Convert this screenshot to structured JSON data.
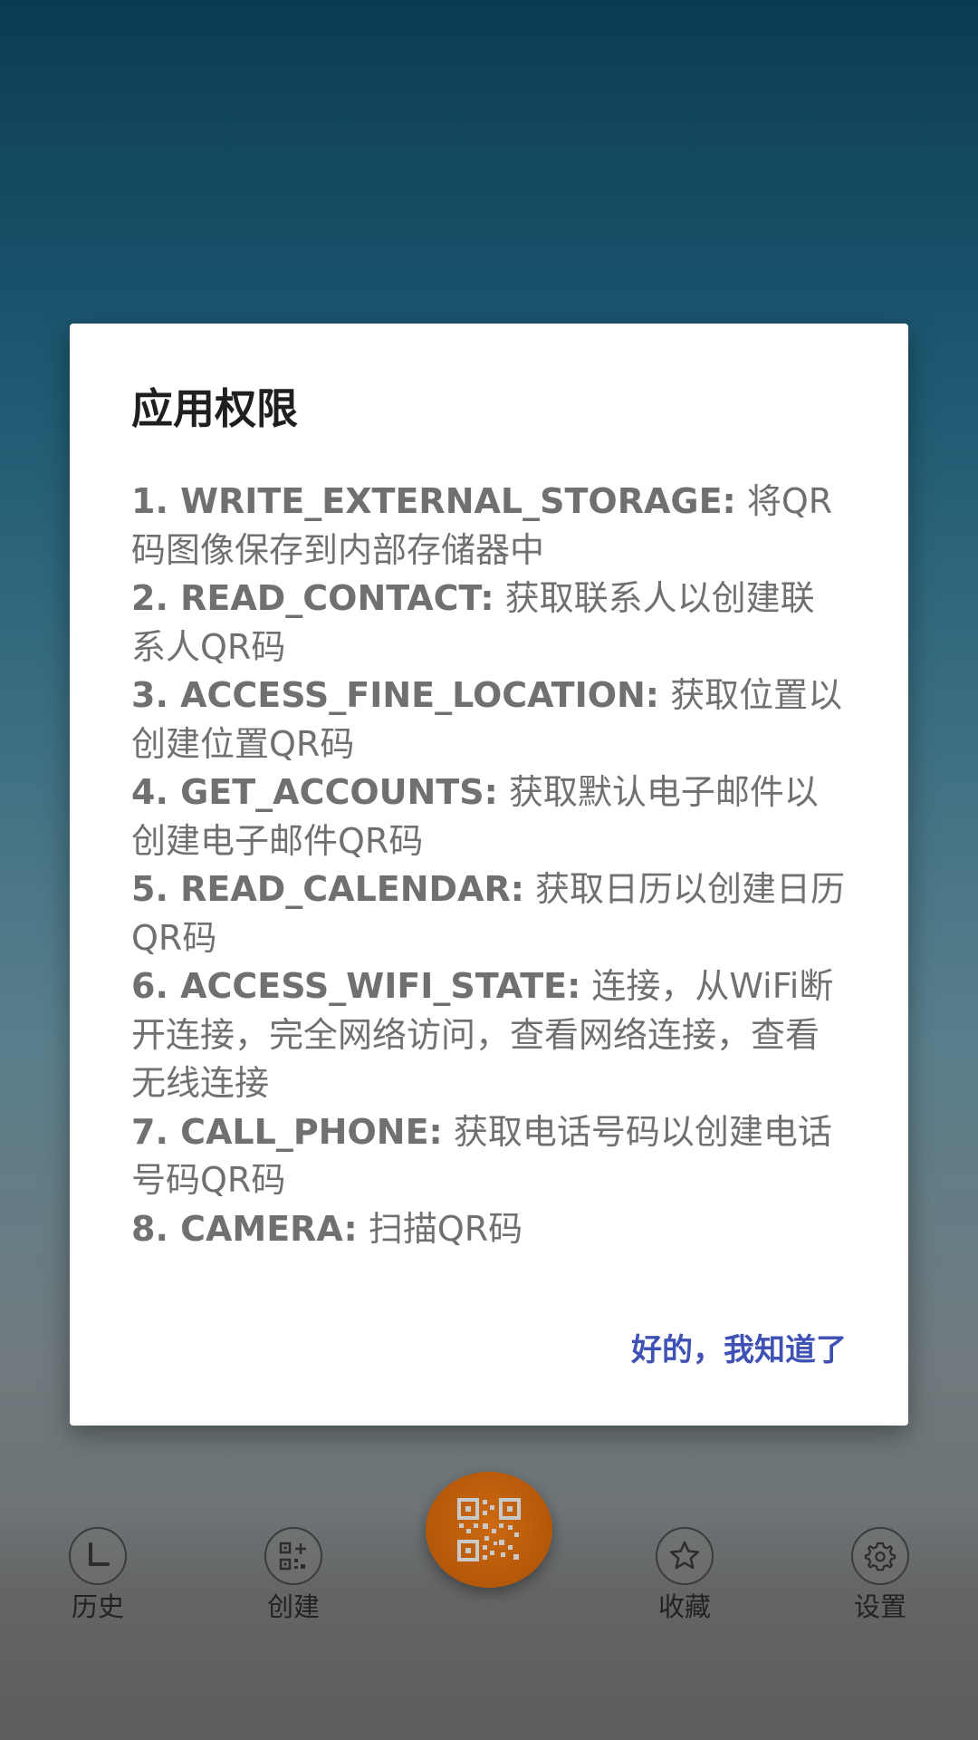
{
  "dialog": {
    "title": "应用权限",
    "permissions": [
      {
        "key": "1. WRITE_EXTERNAL_STORAGE:",
        "desc": " 将QR码图像保存到内部存储器中"
      },
      {
        "key": "2. READ_CONTACT:",
        "desc": " 获取联系人以创建联系人QR码"
      },
      {
        "key": "3. ACCESS_FINE_LOCATION:",
        "desc": " 获取位置以创建位置QR码"
      },
      {
        "key": "4. GET_ACCOUNTS:",
        "desc": " 获取默认电子邮件以创建电子邮件QR码"
      },
      {
        "key": "5. READ_CALENDAR:",
        "desc": " 获取日历以创建日历QR码"
      },
      {
        "key": "6. ACCESS_WIFI_STATE:",
        "desc": " 连接，从WiFi断开连接，完全网络访问，查看网络连接，查看无线连接"
      },
      {
        "key": "7. CALL_PHONE:",
        "desc": " 获取电话号码以创建电话号码QR码"
      },
      {
        "key": "8. CAMERA:",
        "desc": " 扫描QR码"
      }
    ],
    "ok_label": "好的，我知道了"
  },
  "bottom_nav": {
    "items": [
      {
        "label": "历史",
        "icon": "clock-icon"
      },
      {
        "label": "创建",
        "icon": "qr-create-icon"
      },
      {
        "label": "收藏",
        "icon": "star-icon"
      },
      {
        "label": "设置",
        "icon": "gear-icon"
      }
    ],
    "fab_icon": "qr-scan-icon"
  },
  "colors": {
    "accent": "#3f51b5",
    "fab": "#b85a0a",
    "background_top": "#0b3c54"
  }
}
